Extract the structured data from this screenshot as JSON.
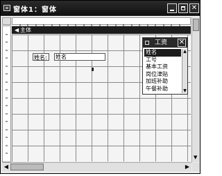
{
  "window": {
    "title": "窗体1：窗体",
    "buttons": {
      "minimize": "",
      "maximize": "",
      "close": ""
    }
  },
  "section": {
    "arrow": "◀",
    "label": "主体"
  },
  "controls": {
    "label_text": "姓名:",
    "textbox_text": "姓名"
  },
  "field_list": {
    "title": "工资",
    "close_label": "✕",
    "items": [
      "姓名",
      "工号",
      "基本工资",
      "岗位津贴",
      "加班补助",
      "午餐补助"
    ],
    "selected_index": 0
  }
}
